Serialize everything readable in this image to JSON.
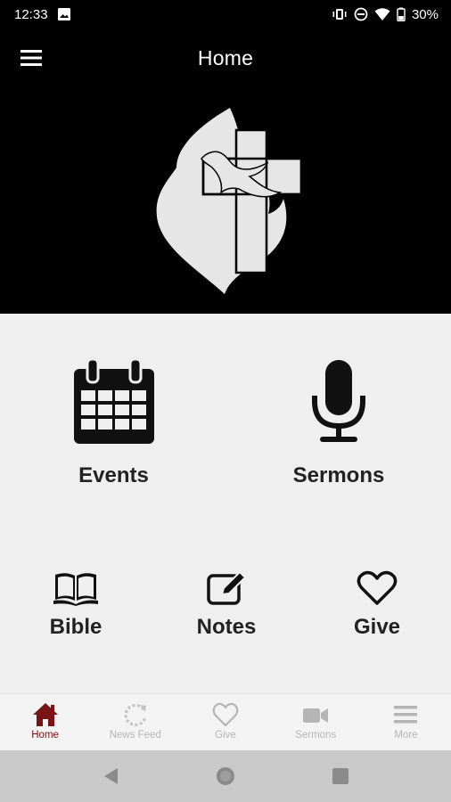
{
  "status_bar": {
    "time": "12:33",
    "battery": "30%"
  },
  "app_bar": {
    "title": "Home"
  },
  "tiles": {
    "events": "Events",
    "sermons": "Sermons",
    "bible": "Bible",
    "notes": "Notes",
    "give": "Give"
  },
  "bottom_nav": [
    {
      "label": "Home",
      "icon": "home-icon",
      "active": true
    },
    {
      "label": "News Feed",
      "icon": "refresh-icon",
      "active": false
    },
    {
      "label": "Give",
      "icon": "heart-icon",
      "active": false
    },
    {
      "label": "Sermons",
      "icon": "video-camera-icon",
      "active": false
    },
    {
      "label": "More",
      "icon": "menu-icon",
      "active": false
    }
  ],
  "colors": {
    "active": "#7a1414",
    "inactive": "#b5b5b5",
    "hero_bg": "#000000",
    "body_bg": "#efefef"
  }
}
